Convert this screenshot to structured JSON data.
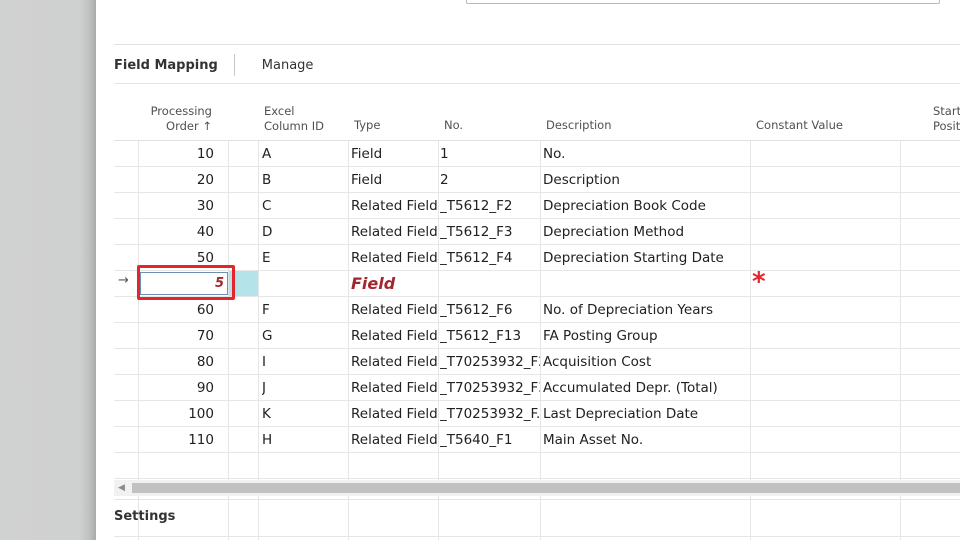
{
  "action_bar": {
    "title": "Field Mapping",
    "manage": "Manage"
  },
  "columns": {
    "processing_order_line1": "Processing",
    "processing_order_line2": "Order ↑",
    "excel_col_line1": "Excel",
    "excel_col_line2": "Column ID",
    "type": "Type",
    "no": "No.",
    "description": "Description",
    "constant_value": "Constant Value",
    "starting_pos_line1": "Starti",
    "starting_pos_line2": "Positi"
  },
  "rows": [
    {
      "order": "10",
      "excel": "A",
      "type": "Field",
      "no": "1",
      "desc": "No."
    },
    {
      "order": "20",
      "excel": "B",
      "type": "Field",
      "no": "2",
      "desc": "Description"
    },
    {
      "order": "30",
      "excel": "C",
      "type": "Related Field",
      "no": "_T5612_F2",
      "desc": "Depreciation Book Code"
    },
    {
      "order": "40",
      "excel": "D",
      "type": "Related Field",
      "no": "_T5612_F3",
      "desc": "Depreciation Method"
    },
    {
      "order": "50",
      "excel": "E",
      "type": "Related Field",
      "no": "_T5612_F4",
      "desc": "Depreciation Starting Date"
    },
    {
      "order": "",
      "excel": "",
      "type": "",
      "no": "",
      "desc": ""
    },
    {
      "order": "60",
      "excel": "F",
      "type": "Related Field",
      "no": "_T5612_F6",
      "desc": "No. of Depreciation Years"
    },
    {
      "order": "70",
      "excel": "G",
      "type": "Related Field",
      "no": "_T5612_F13",
      "desc": "FA Posting Group"
    },
    {
      "order": "80",
      "excel": "I",
      "type": "Related Field",
      "no": "_T70253932_F2",
      "desc": "Acquisition Cost"
    },
    {
      "order": "90",
      "excel": "J",
      "type": "Related Field",
      "no": "_T70253932_F3",
      "desc": "Accumulated Depr. (Total)"
    },
    {
      "order": "100",
      "excel": "K",
      "type": "Related Field",
      "no": "_T70253932_F...",
      "desc": "Last Depreciation Date"
    },
    {
      "order": "110",
      "excel": "H",
      "type": "Related Field",
      "no": "_T5640_F1",
      "desc": "Main Asset No."
    },
    {
      "order": "",
      "excel": "",
      "type": "",
      "no": "",
      "desc": ""
    }
  ],
  "new_row": {
    "order_value": "5",
    "type": "Field",
    "required_marker": "*",
    "arrow": "→"
  },
  "scrollbar": {
    "left_arrow": "◀"
  },
  "settings": {
    "title": "Settings"
  },
  "colors": {
    "error_red": "#e3262b",
    "field_red": "#a4262c",
    "selection_cyan": "#b4e4ea"
  }
}
